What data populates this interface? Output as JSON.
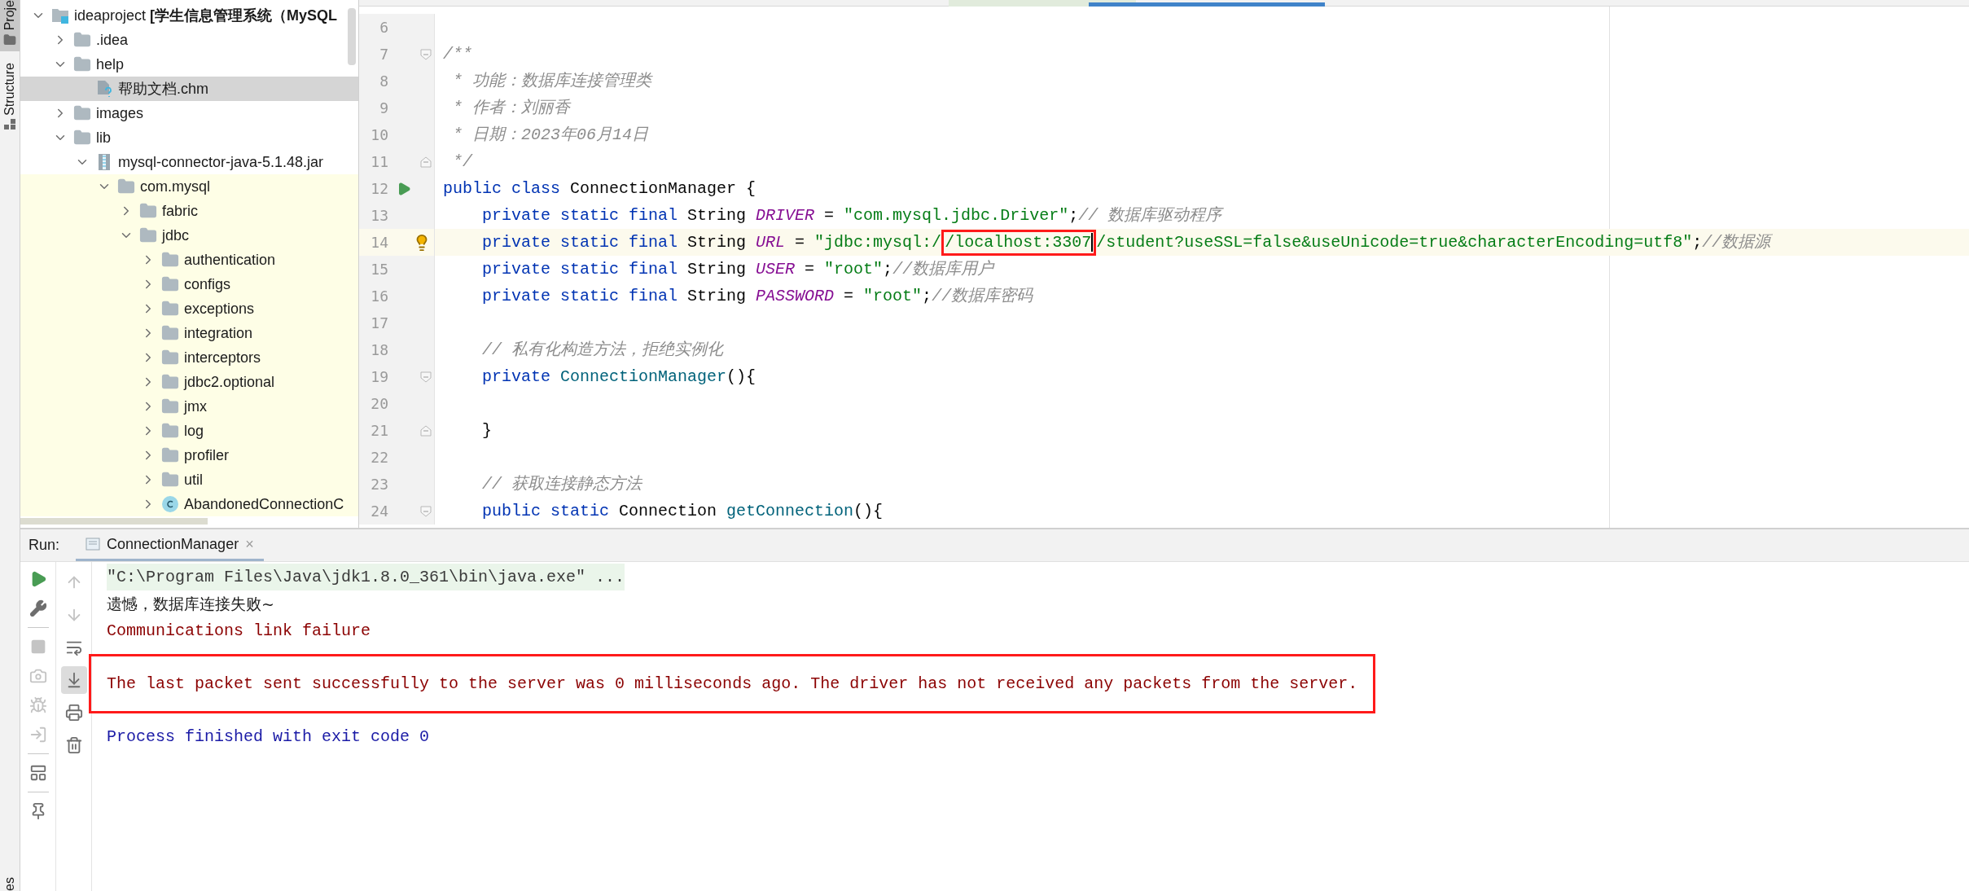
{
  "tool_strip": {
    "tabs": [
      {
        "label": "Proje",
        "selected": true
      },
      {
        "label": "Structure",
        "selected": false
      }
    ],
    "bottom_label": "es"
  },
  "project_tree": [
    {
      "kind": "module",
      "label": "ideaproject **[学生信息管理系统（MySQL**",
      "expanded": true,
      "selected": false,
      "children": [
        {
          "kind": "folder",
          "label": ".idea",
          "expanded": false,
          "selected": false
        },
        {
          "kind": "folder",
          "label": "help",
          "expanded": true,
          "selected": false,
          "children": [
            {
              "kind": "chm",
              "label": "帮助文档.chm",
              "selected": true
            }
          ]
        },
        {
          "kind": "folder",
          "label": "images",
          "expanded": false,
          "selected": false
        },
        {
          "kind": "folder",
          "label": "lib",
          "expanded": true,
          "selected": false,
          "children": [
            {
              "kind": "jar",
              "label": "mysql-connector-java-5.1.48.jar",
              "expanded": true,
              "selected": false,
              "library": true,
              "children": [
                {
                  "kind": "package",
                  "label": "com.mysql",
                  "expanded": true,
                  "selected": false,
                  "children": [
                    {
                      "kind": "package",
                      "label": "fabric",
                      "expanded": false,
                      "selected": false
                    },
                    {
                      "kind": "package",
                      "label": "jdbc",
                      "expanded": true,
                      "selected": false,
                      "children": [
                        {
                          "kind": "package",
                          "label": "authentication",
                          "expanded": false,
                          "selected": false
                        },
                        {
                          "kind": "package",
                          "label": "configs",
                          "expanded": false,
                          "selected": false
                        },
                        {
                          "kind": "package",
                          "label": "exceptions",
                          "expanded": false,
                          "selected": false
                        },
                        {
                          "kind": "package",
                          "label": "integration",
                          "expanded": false,
                          "selected": false
                        },
                        {
                          "kind": "package",
                          "label": "interceptors",
                          "expanded": false,
                          "selected": false
                        },
                        {
                          "kind": "package",
                          "label": "jdbc2.optional",
                          "expanded": false,
                          "selected": false
                        },
                        {
                          "kind": "package",
                          "label": "jmx",
                          "expanded": false,
                          "selected": false
                        },
                        {
                          "kind": "package",
                          "label": "log",
                          "expanded": false,
                          "selected": false
                        },
                        {
                          "kind": "package",
                          "label": "profiler",
                          "expanded": false,
                          "selected": false
                        },
                        {
                          "kind": "package",
                          "label": "util",
                          "expanded": false,
                          "selected": false
                        },
                        {
                          "kind": "class",
                          "label": "AbandonedConnectionC",
                          "expanded": false,
                          "selected": false
                        }
                      ]
                    }
                  ]
                }
              ]
            }
          ]
        }
      ]
    }
  ],
  "editor": {
    "lines": [
      {
        "number": "6"
      },
      {
        "number": "7",
        "kind": "top",
        "gutter": {
          "kind": "fold_open"
        },
        "tokens": [
          {
            "kind": "comment",
            "text": "/**"
          }
        ]
      },
      {
        "number": "8",
        "kind": "doc",
        "tokens": [
          {
            "kind": "comment",
            "text": "* 功能：数据库连接管理类"
          }
        ]
      },
      {
        "number": "9",
        "kind": "doc",
        "tokens": [
          {
            "kind": "comment",
            "text": "* 作者：刘丽香"
          }
        ]
      },
      {
        "number": "10",
        "kind": "doc",
        "tokens": [
          {
            "kind": "comment",
            "text": "* 日期：2023年06月14日"
          }
        ]
      },
      {
        "number": "11",
        "kind": "doc",
        "gutter": {
          "kind": "fold_close"
        },
        "tokens": [
          {
            "kind": "comment",
            "text": "*/"
          }
        ]
      },
      {
        "number": "12",
        "kind": "top",
        "gutter": {
          "kind": "run"
        },
        "tokens": [
          {
            "kind": "keyword",
            "text": "public class"
          },
          {
            "kind": "plain",
            "text": " ConnectionManager {"
          }
        ]
      },
      {
        "number": "13",
        "kind": "member",
        "tokens": [
          {
            "kind": "keyword",
            "text": "private static final"
          },
          {
            "kind": "plain",
            "text": " String "
          },
          {
            "kind": "constant",
            "text": "DRIVER"
          },
          {
            "kind": "plain",
            "text": " = "
          },
          {
            "kind": "string",
            "text": "\"com.mysql.jdbc.Driver\""
          },
          {
            "kind": "plain",
            "text": ";"
          },
          {
            "kind": "comment",
            "text": "// 数据库驱动程序"
          }
        ]
      },
      {
        "number": "14",
        "kind": "member",
        "gutter": {
          "kind": "bulb"
        },
        "current": true,
        "tokens": [
          {
            "kind": "keyword",
            "text": "private static final"
          },
          {
            "kind": "plain",
            "text": " String "
          },
          {
            "kind": "constant",
            "text": "URL"
          },
          {
            "kind": "plain",
            "text": " = "
          },
          {
            "kind": "string",
            "text": "\"jdbc:mysql:/"
          },
          {
            "kind": "string",
            "text": "/localhost:3307",
            "boxed": true,
            "caret_after": true
          },
          {
            "kind": "string",
            "text": "/student?useSSL=false&useUnicode=true&characterEncoding=utf8\""
          },
          {
            "kind": "plain",
            "text": ";"
          },
          {
            "kind": "comment",
            "text": "//数据源"
          }
        ]
      },
      {
        "number": "15",
        "kind": "member",
        "tokens": [
          {
            "kind": "keyword",
            "text": "private static final"
          },
          {
            "kind": "plain",
            "text": " String "
          },
          {
            "kind": "constant",
            "text": "USER"
          },
          {
            "kind": "plain",
            "text": " = "
          },
          {
            "kind": "string",
            "text": "\"root\""
          },
          {
            "kind": "plain",
            "text": ";"
          },
          {
            "kind": "comment",
            "text": "//数据库用户"
          }
        ]
      },
      {
        "number": "16",
        "kind": "member",
        "tokens": [
          {
            "kind": "keyword",
            "text": "private static final"
          },
          {
            "kind": "plain",
            "text": " String "
          },
          {
            "kind": "constant",
            "text": "PASSWORD"
          },
          {
            "kind": "plain",
            "text": " = "
          },
          {
            "kind": "string",
            "text": "\"root\""
          },
          {
            "kind": "plain",
            "text": ";"
          },
          {
            "kind": "comment",
            "text": "//数据库密码"
          }
        ]
      },
      {
        "number": "17"
      },
      {
        "number": "18",
        "kind": "member",
        "tokens": [
          {
            "kind": "comment",
            "text": "// 私有化构造方法，拒绝实例化"
          }
        ]
      },
      {
        "number": "19",
        "kind": "member",
        "gutter": {
          "kind": "fold_open"
        },
        "tokens": [
          {
            "kind": "keyword",
            "text": "private"
          },
          {
            "kind": "method",
            "text": " ConnectionManager"
          },
          {
            "kind": "plain",
            "text": "(){"
          }
        ]
      },
      {
        "number": "20"
      },
      {
        "number": "21",
        "kind": "member",
        "gutter": {
          "kind": "fold_close"
        },
        "tokens": [
          {
            "kind": "plain",
            "text": "}"
          }
        ]
      },
      {
        "number": "22"
      },
      {
        "number": "23",
        "kind": "member",
        "tokens": [
          {
            "kind": "comment",
            "text": "// 获取连接静态方法"
          }
        ]
      },
      {
        "number": "24",
        "kind": "member",
        "gutter": {
          "kind": "fold_open"
        },
        "tokens": [
          {
            "kind": "keyword",
            "text": "public static"
          },
          {
            "kind": "plain",
            "text": " Connection "
          },
          {
            "kind": "method",
            "text": "getConnection"
          },
          {
            "kind": "plain",
            "text": "(){"
          }
        ]
      }
    ]
  },
  "run_panel": {
    "title": "Run:",
    "tabs": [
      {
        "label": "ConnectionManager",
        "close": "×",
        "selected": true
      }
    ],
    "side_tool_groups": [
      {
        "tools": [
          {
            "disabled": false
          },
          {
            "disabled": false
          }
        ]
      },
      {
        "tools": [
          {
            "disabled": true
          },
          {
            "disabled": true
          },
          {
            "disabled": true
          },
          {
            "disabled": true
          }
        ]
      },
      {
        "tools": [
          {
            "disabled": false
          }
        ]
      },
      {
        "tools": [
          {
            "disabled": false
          }
        ]
      }
    ],
    "console_tools": [
      {
        "disabled": true,
        "on": false
      },
      {
        "disabled": true,
        "on": false
      },
      {
        "disabled": false,
        "on": false
      },
      {
        "disabled": false,
        "on": true
      },
      {
        "disabled": false,
        "on": false
      },
      {
        "disabled": false,
        "on": false
      }
    ],
    "console": [
      {
        "kind": "command",
        "text": "\"C:\\Program Files\\Java\\jdk1.8.0_361\\bin\\java.exe\" ..."
      },
      {
        "kind": "output",
        "text": "遗憾，数据库连接失败~"
      },
      {
        "kind": "error",
        "text": "Communications link failure"
      },
      {
        "kind": "blank"
      },
      {
        "kind": "error",
        "text": "The last packet sent successfully to the server was 0 milliseconds ago. The driver has not received any packets from the server.",
        "boxed": true
      },
      {
        "kind": "blank"
      },
      {
        "kind": "info",
        "text": "Process finished with exit code 0"
      }
    ]
  }
}
